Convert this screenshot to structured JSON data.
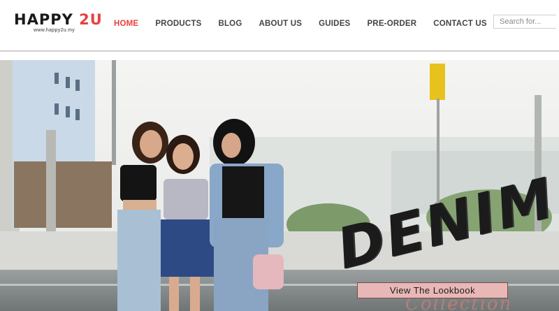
{
  "header": {
    "logo": {
      "prefix": "HAPPY ",
      "accent": "2U",
      "tagline": "www.happy2u.my"
    },
    "nav": [
      {
        "label": "HOME",
        "active": true
      },
      {
        "label": "PRODUCTS",
        "active": false
      },
      {
        "label": "BLOG",
        "active": false
      },
      {
        "label": "ABOUT US",
        "active": false
      },
      {
        "label": "GUIDES",
        "active": false
      },
      {
        "label": "PRE-ORDER",
        "active": false
      },
      {
        "label": "CONTACT US",
        "active": false
      }
    ],
    "search": {
      "placeholder": "Search for..."
    }
  },
  "hero": {
    "title": "DENIM",
    "subtitle": "Collection",
    "cta_label": "View The Lookbook"
  },
  "colors": {
    "accent": "#e8413f",
    "cta_background": "#e8b8b6",
    "subtitle": "#b77d78"
  }
}
